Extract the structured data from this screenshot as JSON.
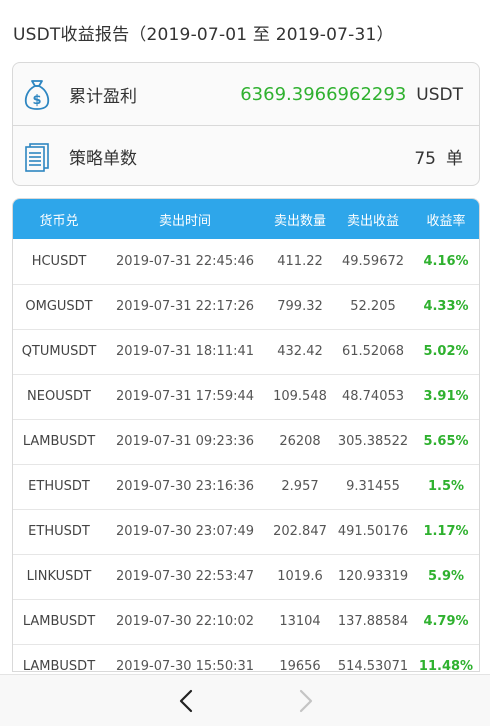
{
  "header": {
    "title": "USDT收益报告（2019-07-01 至 2019-07-31）"
  },
  "summary": {
    "profit": {
      "icon": "money-bag-icon",
      "label": "累计盈利",
      "value": "6369.3966962293",
      "unit": "USDT"
    },
    "orders": {
      "icon": "document-list-icon",
      "label": "策略单数",
      "value": "75",
      "unit": "单"
    }
  },
  "colors": {
    "header_blue": "#2ea6ea",
    "profit_green": "#2fb12f"
  },
  "table": {
    "columns": [
      "货币兑",
      "卖出时间",
      "卖出数量",
      "卖出收益",
      "收益率"
    ],
    "rows": [
      {
        "pair": "HCUSDT",
        "time": "2019-07-31 22:45:46",
        "qty": "411.22",
        "income": "49.59672",
        "rate": "4.16%"
      },
      {
        "pair": "OMGUSDT",
        "time": "2019-07-31 22:17:26",
        "qty": "799.32",
        "income": "52.205",
        "rate": "4.33%"
      },
      {
        "pair": "QTUMUSDT",
        "time": "2019-07-31 18:11:41",
        "qty": "432.42",
        "income": "61.52068",
        "rate": "5.02%"
      },
      {
        "pair": "NEOUSDT",
        "time": "2019-07-31 17:59:44",
        "qty": "109.548",
        "income": "48.74053",
        "rate": "3.91%"
      },
      {
        "pair": "LAMBUSDT",
        "time": "2019-07-31 09:23:36",
        "qty": "26208",
        "income": "305.38522",
        "rate": "5.65%"
      },
      {
        "pair": "ETHUSDT",
        "time": "2019-07-30 23:16:36",
        "qty": "2.957",
        "income": "9.31455",
        "rate": "1.5%"
      },
      {
        "pair": "ETHUSDT",
        "time": "2019-07-30 23:07:49",
        "qty": "202.847",
        "income": "491.50176",
        "rate": "1.17%"
      },
      {
        "pair": "LINKUSDT",
        "time": "2019-07-30 22:53:47",
        "qty": "1019.6",
        "income": "120.93319",
        "rate": "5.9%"
      },
      {
        "pair": "LAMBUSDT",
        "time": "2019-07-30 22:10:02",
        "qty": "13104",
        "income": "137.88584",
        "rate": "4.79%"
      },
      {
        "pair": "LAMBUSDT",
        "time": "2019-07-30 15:50:31",
        "qty": "19656",
        "income": "514.53071",
        "rate": "11.48%"
      }
    ]
  },
  "nav": {
    "back_icon": "chevron-left-icon",
    "forward_icon": "chevron-right-icon"
  }
}
